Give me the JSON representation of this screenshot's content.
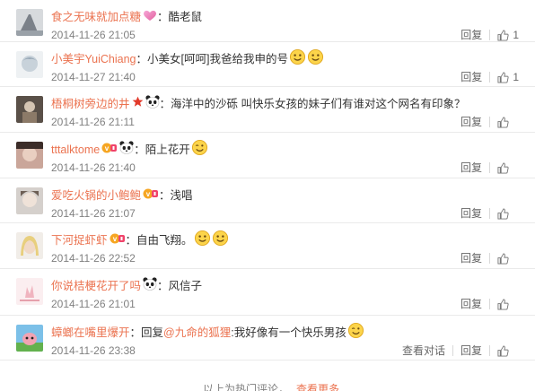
{
  "comments": [
    {
      "user": "食之无味就加点糖",
      "badges": [
        "heart"
      ],
      "reply_to": "",
      "text": "：酷老鼠",
      "emojis": [],
      "time": "2014-11-26 21:05",
      "show_dialog": false,
      "likes": "1"
    },
    {
      "user": "小美宇YuiChiang",
      "badges": [],
      "reply_to": "",
      "text": "：小美女[呵呵]我爸给我申的号",
      "emojis": [
        "smile",
        "smile"
      ],
      "time": "2014-11-27 21:40",
      "show_dialog": false,
      "likes": "1"
    },
    {
      "user": "梧桐树旁边的井",
      "badges": [
        "star",
        "panda"
      ],
      "reply_to": "",
      "text": "：海洋中的沙砾 叫快乐女孩的妹子们有谁对这个网名有印象？",
      "emojis": [],
      "time": "2014-11-26 21:11",
      "show_dialog": false,
      "likes": ""
    },
    {
      "user": "tttalktome",
      "badges": [
        "vip",
        "panda"
      ],
      "reply_to": "",
      "text": "：陌上花开",
      "emojis": [
        "wink"
      ],
      "time": "2014-11-26 21:40",
      "show_dialog": false,
      "likes": ""
    },
    {
      "user": "爱吃火锅的小鲍鲍",
      "badges": [
        "vip"
      ],
      "reply_to": "",
      "text": "：浅唱",
      "emojis": [],
      "time": "2014-11-26 21:07",
      "show_dialog": false,
      "likes": ""
    },
    {
      "user": "下河捉虾虾",
      "badges": [
        "vip"
      ],
      "reply_to": "",
      "text": "：自由飞翔。",
      "emojis": [
        "smile",
        "smile"
      ],
      "time": "2014-11-26 22:52",
      "show_dialog": false,
      "likes": ""
    },
    {
      "user": "你说桔梗花开了吗",
      "badges": [
        "panda"
      ],
      "reply_to": "",
      "text": "：风信子",
      "emojis": [],
      "time": "2014-11-26 21:01",
      "show_dialog": false,
      "likes": ""
    },
    {
      "user": "蟑螂在嘴里爆开",
      "badges": [],
      "reply_to": "@九命的狐狸",
      "text_prefix": "：回复",
      "text": ":我好像有一个快乐男孩",
      "emojis": [
        "wink"
      ],
      "time": "2014-11-26 23:38",
      "show_dialog": true,
      "likes": ""
    }
  ],
  "labels": {
    "reply": "回复",
    "dialog": "查看对话"
  },
  "footer": {
    "text": "以上为热门评论，",
    "more": "查看更多"
  },
  "colors": {
    "username": "#eb7350",
    "text": "#333333",
    "time": "#808080"
  }
}
